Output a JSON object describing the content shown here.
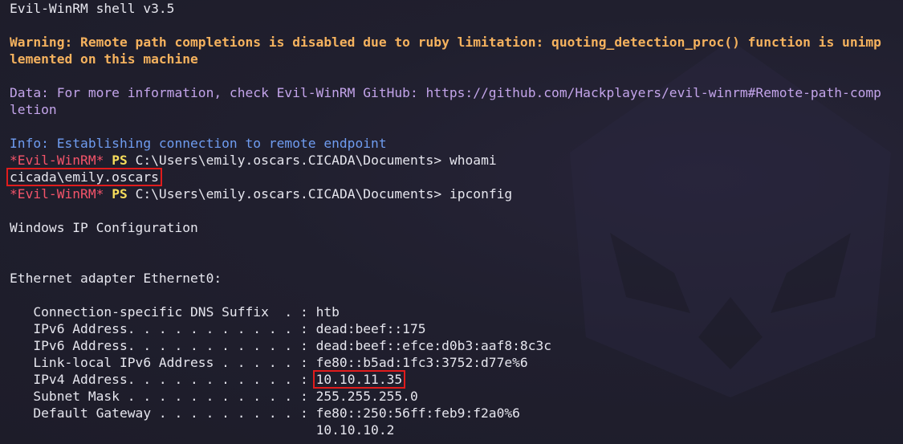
{
  "terminal": {
    "banner": "Evil-WinRM shell v3.5",
    "warning_line1": "Warning: Remote path completions is disabled due to ruby limitation: quoting_detection_proc() function is unimp",
    "warning_line2": "lemented on this machine",
    "data_line1": "Data: For more information, check Evil-WinRM GitHub: https://github.com/Hackplayers/evil-winrm#Remote-path-comp",
    "data_line2": "letion",
    "info_line": "Info: Establishing connection to remote endpoint",
    "prompt": {
      "name": "*Evil-WinRM*",
      "ps": "PS",
      "path": "C:\\Users\\emily.oscars.CICADA\\Documents>"
    },
    "commands": {
      "cmd1": "whoami",
      "cmd2": "ipconfig"
    },
    "whoami_output": "cicada\\emily.oscars",
    "ipconfig": {
      "title": "Windows IP Configuration",
      "adapter": "Ethernet adapter Ethernet0:",
      "rows": [
        {
          "label": "   Connection-specific DNS Suffix  . : ",
          "value": "htb"
        },
        {
          "label": "   IPv6 Address. . . . . . . . . . . : ",
          "value": "dead:beef::175"
        },
        {
          "label": "   IPv6 Address. . . . . . . . . . . : ",
          "value": "dead:beef::efce:d0b3:aaf8:8c3c"
        },
        {
          "label": "   Link-local IPv6 Address . . . . . : ",
          "value": "fe80::b5ad:1fc3:3752:d77e%6"
        },
        {
          "label": "   IPv4 Address. . . . . . . . . . . : ",
          "value": "10.10.11.35"
        },
        {
          "label": "   Subnet Mask . . . . . . . . . . . : ",
          "value": "255.255.255.0"
        },
        {
          "label": "   Default Gateway . . . . . . . . . : ",
          "value": "fe80::250:56ff:feb9:f2a0%6"
        },
        {
          "label": "                                       ",
          "value": "10.10.10.2"
        }
      ]
    }
  },
  "colors": {
    "background": "#1e1d2b",
    "warning": "#f5b25e",
    "data": "#c3a4ea",
    "info": "#6f9cf0",
    "prompt_name": "#f5546a",
    "prompt_ps": "#f7dd5c",
    "highlight_box": "#e01c1c"
  }
}
